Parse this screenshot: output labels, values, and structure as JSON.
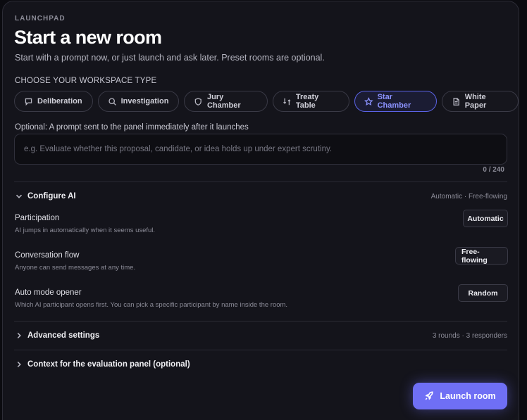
{
  "header": {
    "eyebrow": "LAUNCHPAD",
    "title": "Start a new room",
    "subtitle": "Start with a prompt now, or just launch and ask later. Preset rooms are optional."
  },
  "workspace": {
    "label": "CHOOSE YOUR WORKSPACE TYPE",
    "types": [
      {
        "label": "Deliberation",
        "icon": "chat-bubble-icon"
      },
      {
        "label": "Investigation",
        "icon": "search-icon"
      },
      {
        "label": "Jury Chamber",
        "icon": "shield-icon"
      },
      {
        "label": "Treaty Table",
        "icon": "swap-icon"
      },
      {
        "label": "Star Chamber",
        "icon": "star-icon",
        "selected": true
      },
      {
        "label": "White Paper",
        "icon": "document-icon"
      }
    ],
    "accent_color": "#6f6ff5"
  },
  "prompt": {
    "label": "Optional: A prompt sent to the panel immediately after it launches",
    "value": "",
    "placeholder": "e.g. Evaluate whether this proposal, candidate, or idea holds up under expert scrutiny.",
    "counter": "0 / 240"
  },
  "configure_ai": {
    "title": "Configure AI",
    "summary": "Automatic · Free-flowing",
    "expanded": true,
    "settings": [
      {
        "name": "Participation",
        "desc": "AI jumps in automatically when it seems useful.",
        "value": "Automatic"
      },
      {
        "name": "Conversation flow",
        "desc": "Anyone can send messages at any time.",
        "value": "Free-flowing"
      },
      {
        "name": "Auto mode opener",
        "desc": "Which AI participant opens first. You can pick a specific participant by name inside the room.",
        "value": "Random"
      }
    ]
  },
  "advanced": {
    "title": "Advanced settings",
    "summary": "3 rounds · 3 responders"
  },
  "context": {
    "title": "Context for the evaluation panel (optional)"
  },
  "launch": {
    "label": "Launch room",
    "icon": "rocket-icon"
  }
}
